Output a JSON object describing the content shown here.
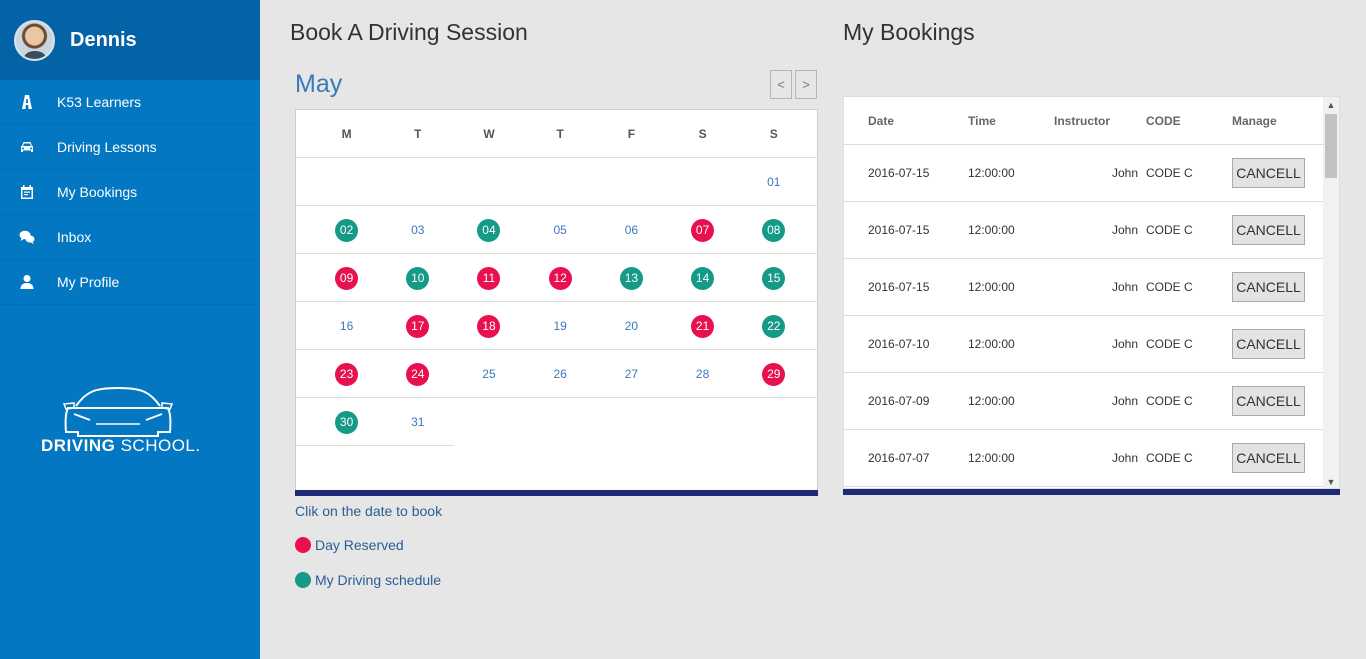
{
  "user": {
    "name": "Dennis"
  },
  "sidebar": {
    "items": [
      {
        "label": "K53 Learners",
        "icon": "road-icon"
      },
      {
        "label": "Driving Lessons",
        "icon": "car-icon"
      },
      {
        "label": "My Bookings",
        "icon": "calendar-icon"
      },
      {
        "label": "Inbox",
        "icon": "chat-icon"
      },
      {
        "label": "My Profile",
        "icon": "user-icon"
      }
    ]
  },
  "logo": {
    "text_bold": "DRIVING",
    "text_light": "SCHOOL"
  },
  "booking_section": {
    "title": "Book A Driving Session",
    "month": "May",
    "prev": "<",
    "next": ">",
    "weekdays": [
      "M",
      "T",
      "W",
      "T",
      "F",
      "S",
      "S"
    ],
    "weeks": [
      [
        null,
        null,
        null,
        null,
        null,
        null,
        {
          "d": "01",
          "s": "none"
        }
      ],
      [
        {
          "d": "02",
          "s": "mine"
        },
        {
          "d": "03",
          "s": "none"
        },
        {
          "d": "04",
          "s": "mine"
        },
        {
          "d": "05",
          "s": "none"
        },
        {
          "d": "06",
          "s": "none"
        },
        {
          "d": "07",
          "s": "reserved"
        },
        {
          "d": "08",
          "s": "mine"
        }
      ],
      [
        {
          "d": "09",
          "s": "reserved"
        },
        {
          "d": "10",
          "s": "mine"
        },
        {
          "d": "11",
          "s": "reserved"
        },
        {
          "d": "12",
          "s": "reserved"
        },
        {
          "d": "13",
          "s": "mine"
        },
        {
          "d": "14",
          "s": "mine"
        },
        {
          "d": "15",
          "s": "mine"
        }
      ],
      [
        {
          "d": "16",
          "s": "none"
        },
        {
          "d": "17",
          "s": "reserved"
        },
        {
          "d": "18",
          "s": "reserved"
        },
        {
          "d": "19",
          "s": "none"
        },
        {
          "d": "20",
          "s": "none"
        },
        {
          "d": "21",
          "s": "reserved"
        },
        {
          "d": "22",
          "s": "mine"
        }
      ],
      [
        {
          "d": "23",
          "s": "reserved"
        },
        {
          "d": "24",
          "s": "reserved"
        },
        {
          "d": "25",
          "s": "none"
        },
        {
          "d": "26",
          "s": "none"
        },
        {
          "d": "27",
          "s": "none"
        },
        {
          "d": "28",
          "s": "none"
        },
        {
          "d": "29",
          "s": "reserved"
        }
      ],
      [
        {
          "d": "30",
          "s": "mine"
        },
        {
          "d": "31",
          "s": "none"
        }
      ]
    ],
    "hint": "Clik on the date to book",
    "legend": [
      {
        "label": "Day Reserved",
        "color": "#e8104f"
      },
      {
        "label": "My Driving schedule",
        "color": "#159a87"
      }
    ]
  },
  "colors": {
    "reserved": "#e8104f",
    "mine": "#159a87"
  },
  "my_bookings": {
    "title": "My Bookings",
    "columns": [
      "Date",
      "Time",
      "Instructor",
      "CODE",
      "Manage"
    ],
    "rows": [
      {
        "date": "2016-07-15",
        "time": "12:00:00",
        "instructor": "John",
        "code": "CODE C",
        "action": "CANCELL"
      },
      {
        "date": "2016-07-15",
        "time": "12:00:00",
        "instructor": "John",
        "code": "CODE C",
        "action": "CANCELL"
      },
      {
        "date": "2016-07-15",
        "time": "12:00:00",
        "instructor": "John",
        "code": "CODE C",
        "action": "CANCELL"
      },
      {
        "date": "2016-07-10",
        "time": "12:00:00",
        "instructor": "John",
        "code": "CODE C",
        "action": "CANCELL"
      },
      {
        "date": "2016-07-09",
        "time": "12:00:00",
        "instructor": "John",
        "code": "CODE C",
        "action": "CANCELL"
      },
      {
        "date": "2016-07-07",
        "time": "12:00:00",
        "instructor": "John",
        "code": "CODE C",
        "action": "CANCELL"
      }
    ]
  }
}
